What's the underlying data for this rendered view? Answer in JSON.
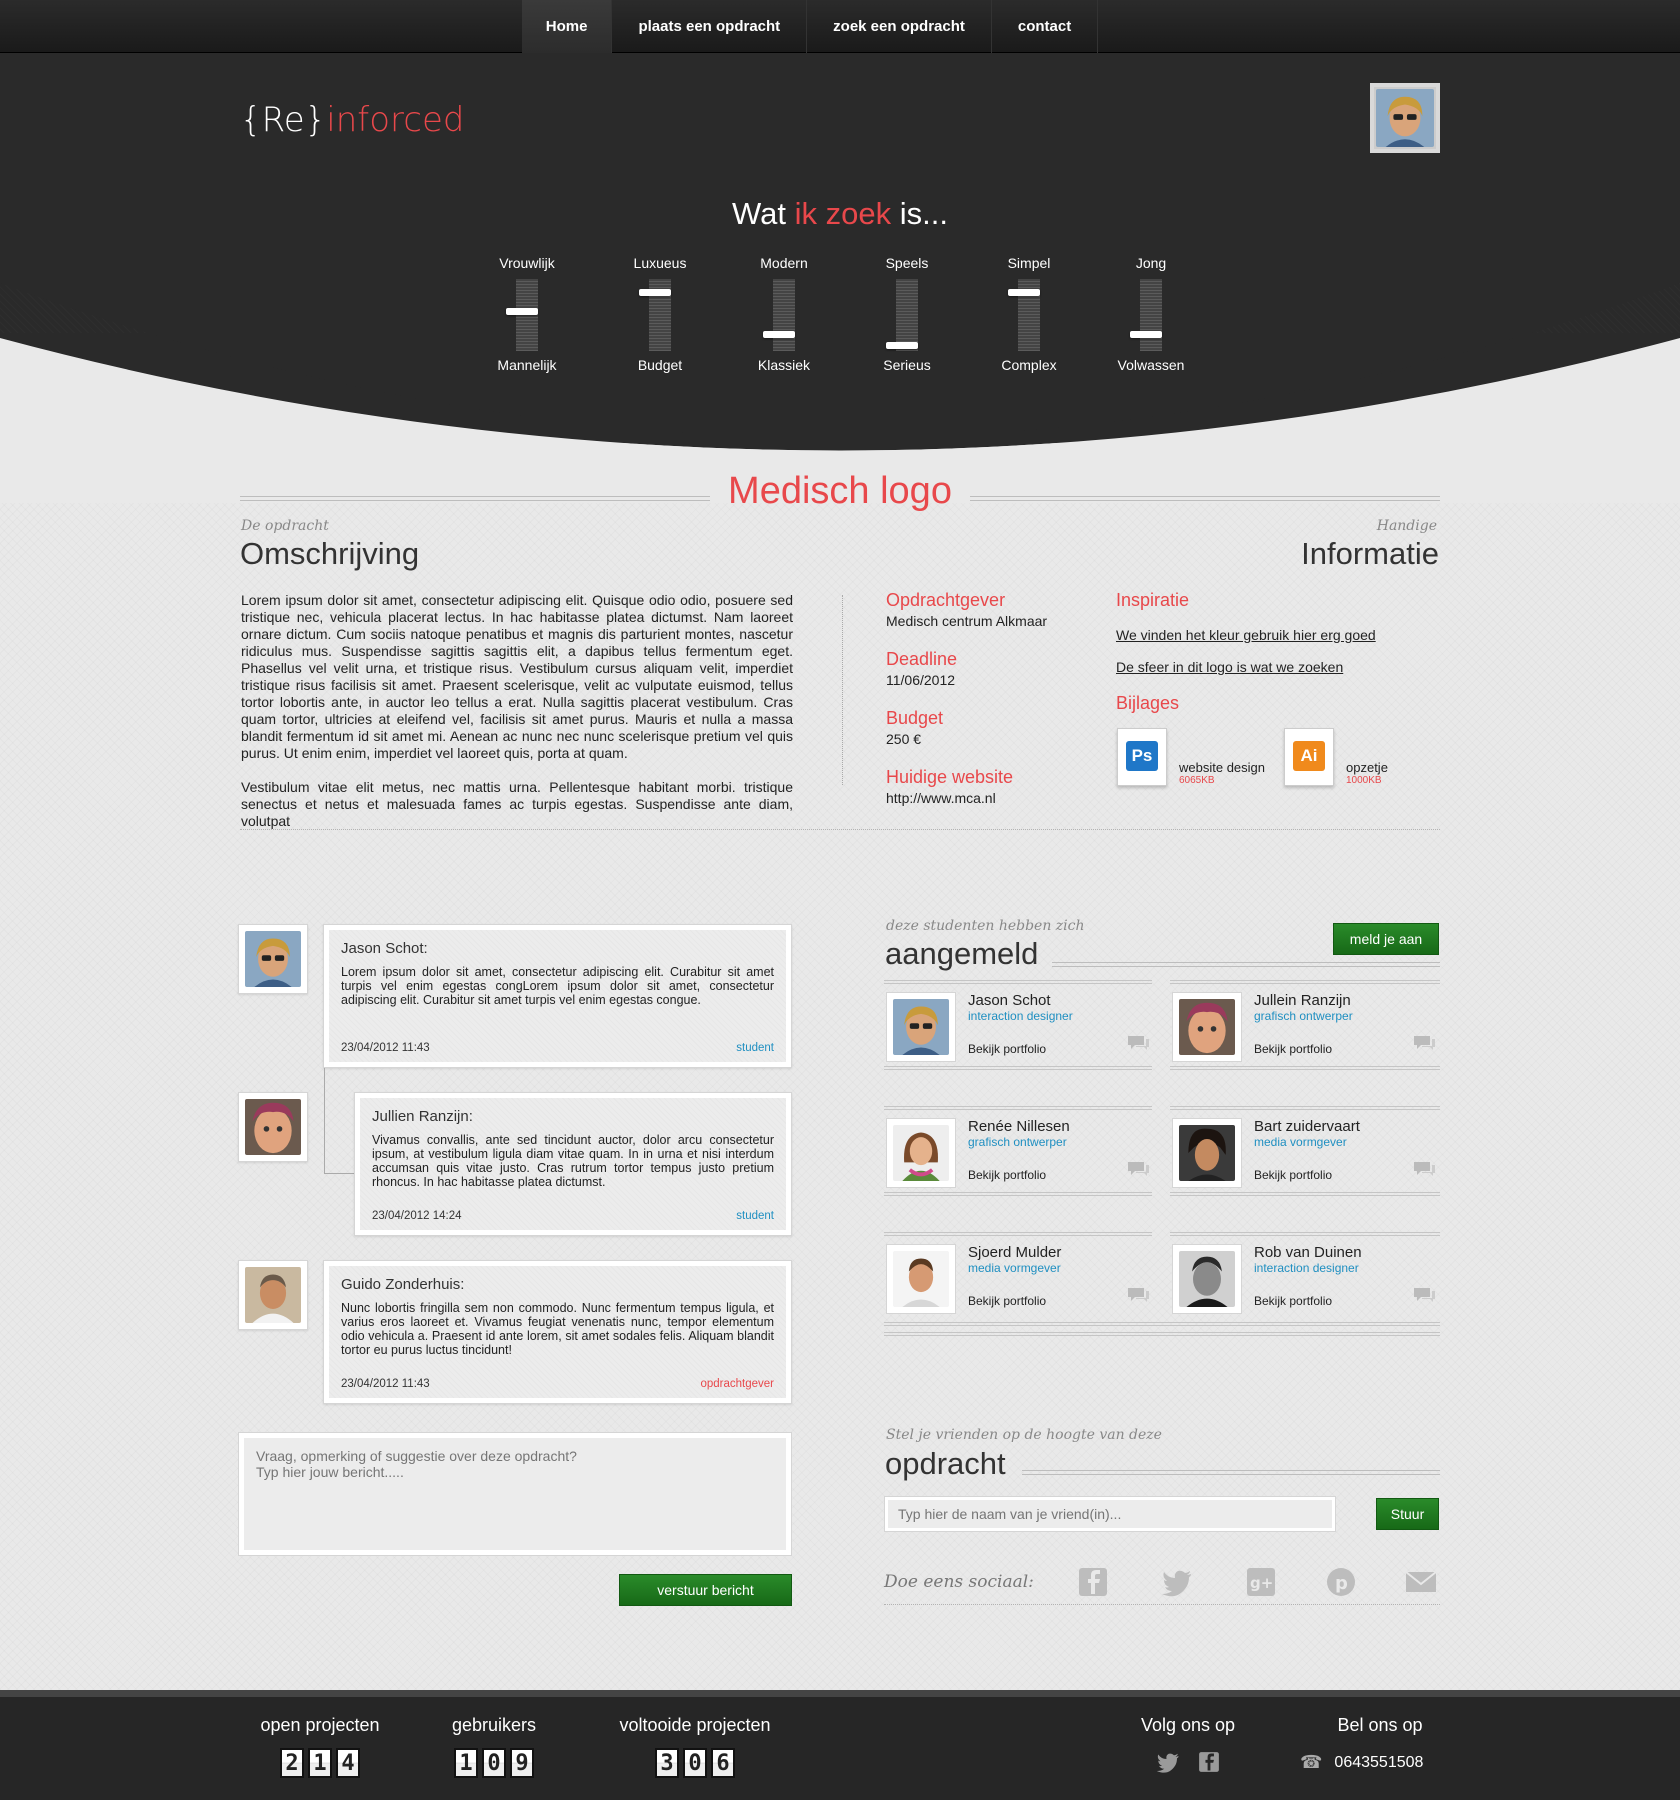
{
  "nav": {
    "items": [
      "Home",
      "plaats een opdracht",
      "zoek een opdracht",
      "contact"
    ],
    "active": "Home"
  },
  "header": {
    "logo_prefix": "{Re}",
    "logo_suffix": "inforced",
    "title_before": "Wat ",
    "title_highlight": "ik zoek",
    "title_after": " is...",
    "sliders": [
      {
        "top": "Vrouwlijk",
        "bottom": "Mannelijk",
        "level": 0.55
      },
      {
        "top": "Luxueus",
        "bottom": "Budget",
        "level": 0.85
      },
      {
        "top": "Modern",
        "bottom": "Klassiek",
        "level": 0.2
      },
      {
        "top": "Speels",
        "bottom": "Serieus",
        "level": 0.03
      },
      {
        "top": "Simpel",
        "bottom": "Complex",
        "level": 0.85
      },
      {
        "top": "Jong",
        "bottom": "Volwassen",
        "level": 0.2
      }
    ]
  },
  "project": {
    "title": "Medisch logo",
    "desc_kicker": "De opdracht",
    "desc_heading": "Omschrijving",
    "paragraph1": "Lorem ipsum dolor sit amet, consectetur adipiscing elit. Quisque odio odio, posuere sed tristique nec, vehicula placerat lectus. In hac habitasse platea dictumst. Nam laoreet ornare dictum. Cum sociis natoque penatibus et magnis dis parturient montes, nascetur ridiculus mus. Suspendisse sagittis sagittis elit, a dapibus tellus fermentum eget. Phasellus vel velit urna, et tristique risus. Vestibulum cursus aliquam velit, imperdiet tristique risus facilisis sit amet. Praesent scelerisque, velit ac vulputate euismod, tellus tortor lobortis ante, in auctor leo tellus a erat. Nulla sagittis placerat vestibulum. Cras quam tortor, ultricies at eleifend vel, facilisis sit amet purus. Mauris et nulla a massa blandit fermentum id sit amet mi. Aenean ac nunc nec nunc scelerisque pretium vel quis purus. Ut enim enim, imperdiet vel laoreet quis, porta at quam.",
    "paragraph2": "Vestibulum vitae elit metus, nec mattis urna. Pellentesque habitant morbi. tristique senectus et netus et malesuada fames ac turpis egestas. Suspendisse ante diam, volutpat",
    "info_kicker": "Handige",
    "info_heading": "Informatie",
    "info": [
      {
        "label": "Opdrachtgever",
        "value": "Medisch centrum Alkmaar"
      },
      {
        "label": "Deadline",
        "value": "11/06/2012"
      },
      {
        "label": "Budget",
        "value": "250 €"
      },
      {
        "label": "Huidige website",
        "value": "http://www.mca.nl"
      }
    ],
    "inspiration_label": "Inspiratie",
    "inspiration_links": [
      "We vinden het kleur gebruik hier erg goed",
      "De sfeer in dit logo is wat we zoeken"
    ],
    "attachments_label": "Bijlages",
    "attachments": [
      {
        "badge": "Ps",
        "name": "website design",
        "size": "6065KB",
        "color": "#1f77c8"
      },
      {
        "badge": "Ai",
        "name": "opzetje",
        "size": "1000KB",
        "color": "#f08a1c"
      }
    ]
  },
  "comments": [
    {
      "author": "Jason Schot:",
      "text": "Lorem ipsum dolor sit amet, consectetur adipiscing elit. Curabitur sit amet turpis vel enim egestas congLorem ipsum dolor sit amet, consectetur adipiscing elit. Curabitur sit amet turpis vel enim egestas congue.",
      "date": "23/04/2012 11:43",
      "role": "student",
      "role_color": "#1f8fc1"
    },
    {
      "author": "Jullien Ranzijn:",
      "text": "Vivamus convallis, ante sed tincidunt auctor, dolor arcu consectetur ipsum, at vestibulum ligula diam vitae quam. In in urna et nisi interdum accumsan quis vitae justo. Cras rutrum tortor tempus justo pretium rhoncus. In hac habitasse platea dictumst.",
      "date": "23/04/2012 14:24",
      "role": "student",
      "role_color": "#1f8fc1"
    },
    {
      "author": "Guido Zonderhuis:",
      "text": "Nunc lobortis fringilla sem non commodo. Nunc fermentum tempus ligula, et varius eros laoreet et. Vivamus feugiat venenatis nunc, tempor elementum odio vehicula a. Praesent id ante lorem, sit amet sodales felis. Aliquam blandit tortor eu purus luctus tincidunt!",
      "date": "23/04/2012 11:43",
      "role": "opdrachtgever",
      "role_color": "#e8484b"
    }
  ],
  "message": {
    "placeholder": "Vraag, opmerking of suggestie over deze opdracht?\nTyp hier jouw bericht.....",
    "send_label": "verstuur bericht"
  },
  "students": {
    "kicker": "deze studenten hebben zich",
    "heading": "aangemeld",
    "signup_label": "meld je aan",
    "portfolio_label": "Bekijk portfolio",
    "list": [
      {
        "name": "Jason Schot",
        "role": "interaction designer"
      },
      {
        "name": "Jullein Ranzijn",
        "role": "grafisch ontwerper"
      },
      {
        "name": "Renée Nillesen",
        "role": "grafisch ontwerper"
      },
      {
        "name": "Bart zuidervaart",
        "role": "media vormgever"
      },
      {
        "name": "Sjoerd Mulder",
        "role": "media vormgever"
      },
      {
        "name": "Rob van Duinen",
        "role": "interaction designer"
      }
    ]
  },
  "share": {
    "kicker": "Stel je vrienden op de hoogte van deze",
    "heading": "opdracht",
    "placeholder": "Typ hier de naam van je vriend(in)...",
    "send_label": "Stuur",
    "social_label": "Doe eens sociaal:",
    "icons": [
      "facebook-icon",
      "twitter-icon",
      "googleplus-icon",
      "pinterest-icon",
      "mail-icon"
    ]
  },
  "footer": {
    "stats": [
      {
        "label": "open projecten",
        "digits": [
          "2",
          "1",
          "4"
        ]
      },
      {
        "label": "gebruikers",
        "digits": [
          "1",
          "0",
          "9"
        ]
      },
      {
        "label": "voltooide projecten",
        "digits": [
          "3",
          "0",
          "6"
        ]
      }
    ],
    "follow_label": "Volg ons op",
    "call_label": "Bel ons op",
    "phone": "0643551508"
  },
  "colors": {
    "accent": "#e8484b",
    "green": "#1e7a1e",
    "link_blue": "#1f8fc1"
  }
}
